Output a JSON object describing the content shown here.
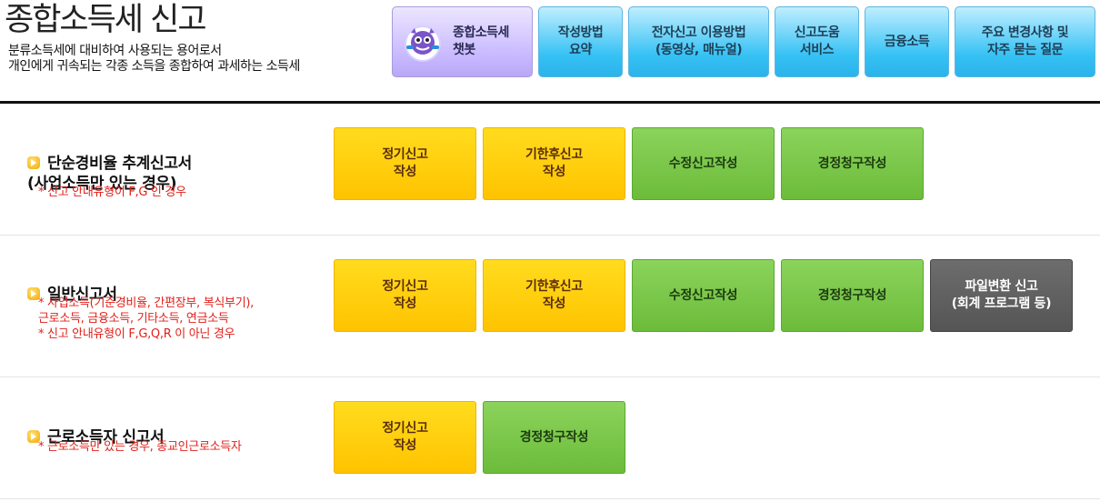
{
  "header": {
    "title": "종합소득세 신고",
    "description": "분류소득세에 대비하여 사용되는 용어로서\n개인에게 귀속되는 각종 소득을 종합하여 과세하는 소득세",
    "buttons": {
      "chatbot": "종합소득세\n챗봇",
      "guide_summary": "작성방법\n요약",
      "e_filing_guide": "전자신고 이용방법\n(동영상, 매뉴얼)",
      "filing_help": "신고도움\n서비스",
      "financial_income": "금융소득",
      "changes_faq": "주요 변경사항 및\n자주 묻는 질문"
    }
  },
  "sections": {
    "simple": {
      "title": "단순경비율 추계신고서\n(사업소득만 있는 경우)",
      "note": "* 신고 안내유형이 F,G 인 경우",
      "regular": "정기신고\n작성",
      "late": "기한후신고\n작성",
      "amend": "수정신고작성",
      "correction": "경정청구작성"
    },
    "general": {
      "title": "일반신고서",
      "note": "* 사업소득(기준경비율, 간편장부, 복식부기),\n근로소득, 금융소득, 기타소득, 연금소득\n* 신고 안내유형이 F,G,Q,R 이 아닌 경우",
      "regular": "정기신고\n작성",
      "late": "기한후신고\n작성",
      "amend": "수정신고작성",
      "correction": "경정청구작성",
      "file_convert": "파일변환 신고\n(회계 프로그램 등)"
    },
    "earned": {
      "title": "근로소득자 신고서",
      "note": "* 근로소득만 있는 경우, 종교인근로소득자",
      "regular": "정기신고\n작성",
      "correction": "경정청구작성"
    }
  },
  "colors": {
    "yellow_button": "#ffc300",
    "green_button": "#6cbc3a",
    "gray_button": "#555555",
    "header_button": "#35c1f4",
    "chatbot_button": "#c8b9ff",
    "note_text": "#e0201a"
  }
}
